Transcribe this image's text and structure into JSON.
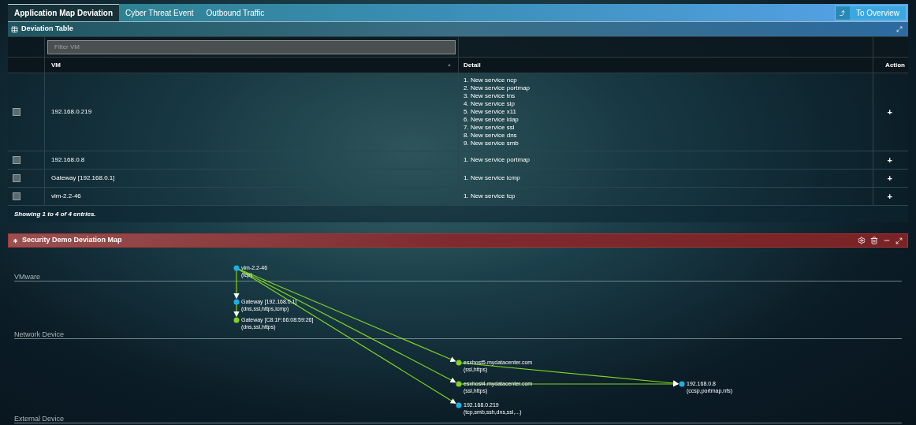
{
  "tabs": [
    {
      "label": "Application Map Deviation",
      "selected": true
    },
    {
      "label": "Cyber Threat Event",
      "selected": false
    },
    {
      "label": "Outbound Traffic",
      "selected": false
    }
  ],
  "overview_button": {
    "label": "To Overview"
  },
  "deviation_table": {
    "title": "Deviation Table",
    "filter": {
      "placeholder": "Filter VM"
    },
    "columns": [
      "VM",
      "Detail",
      "Action"
    ],
    "sort_indicator": "▲",
    "rows": [
      {
        "checked": false,
        "vm": "192.168.0.219",
        "detail": [
          "1. New service ncp",
          "2. New service portmap",
          "3. New service tns",
          "4. New service sip",
          "5. New service x11",
          "6. New service ldap",
          "7. New service ssl",
          "8. New service dns",
          "9. New service smb"
        ],
        "action": "+"
      },
      {
        "checked": false,
        "vm": "192.168.0.8",
        "detail": [
          "1. New service portmap"
        ],
        "action": "+"
      },
      {
        "checked": false,
        "vm": "Gateway [192.168.0.1]",
        "detail": [
          "1. New service icmp"
        ],
        "action": "+"
      },
      {
        "checked": false,
        "vm": "vim-2.2-46",
        "detail": [
          "1. New service tcp"
        ],
        "action": "+"
      }
    ],
    "footer": "Showing 1 to 4 of 4 entries."
  },
  "map": {
    "title": "Security Demo Deviation Map",
    "lanes": [
      "VMware",
      "Network Device",
      "External Device"
    ],
    "nodes": [
      {
        "name": "vim-2.2-46",
        "services": "(tcp)",
        "color": "#1ab0e8"
      },
      {
        "name": "Gateway [192.168.0.1]",
        "services": "(dns,ssl,https,icmp)",
        "color": "#1ab0e8"
      },
      {
        "name": "Gateway [C8:1F:66:08:59:26]",
        "services": "(dns,ssl,https)",
        "color": "#7ed321"
      },
      {
        "name": "esxhost5.mydatacenter.com",
        "services": "(ssl,https)",
        "color": "#7ed321"
      },
      {
        "name": "esxhost4.mydatacenter.com",
        "services": "(ssl,https)",
        "color": "#7ed321"
      },
      {
        "name": "192.168.0.219",
        "services": "(tcp,smb,ssh,dns,ssl,...)",
        "color": "#1ab0e8"
      },
      {
        "name": "192.168.0.8",
        "services": "(ccsp,portmap,nfs)",
        "color": "#1ab0e8"
      }
    ]
  }
}
